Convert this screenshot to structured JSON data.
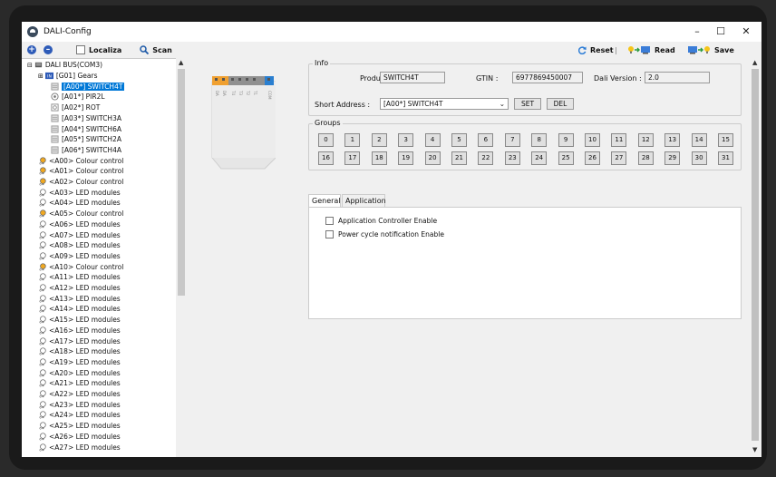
{
  "window": {
    "title": "DALI-Config",
    "minimize": "–",
    "maximize": "☐",
    "close": "✕"
  },
  "toolbar": {
    "add_label": "+",
    "remove_label": "–",
    "localiza_label": "Localiza",
    "scan_label": "Scan",
    "reset_label": "Reset",
    "separator": "|",
    "read_label": "Read",
    "save_label": "Save"
  },
  "tree": {
    "root": "DALI BUS(COM3)",
    "gears": "[G01] Gears",
    "items": [
      "[A00*] SWITCH4T",
      "[A01*] PIR2L",
      "[A02*] ROT",
      "[A03*] SWITCH3A",
      "[A04*] SWITCH6A",
      "[A05*] SWITCH2A",
      "[A06*] SWITCH4A"
    ],
    "gear_items": [
      "<A00> Colour control",
      "<A01> Colour control",
      "<A02> Colour control",
      "<A03> LED modules",
      "<A04> LED modules",
      "<A05> Colour control",
      "<A06> LED modules",
      "<A07> LED modules",
      "<A08> LED modules",
      "<A09> LED modules",
      "<A10> Colour control",
      "<A11> LED modules",
      "<A12> LED modules",
      "<A13> LED modules",
      "<A14> LED modules",
      "<A15> LED modules",
      "<A16> LED modules",
      "<A17> LED modules",
      "<A18> LED modules",
      "<A19> LED modules",
      "<A20> LED modules",
      "<A21> LED modules",
      "<A22> LED modules",
      "<A23> LED modules",
      "<A24> LED modules",
      "<A25> LED modules",
      "<A26> LED modules",
      "<A27> LED modules"
    ]
  },
  "info": {
    "legend": "Info",
    "product_label": "Product :",
    "product_value": "SWITCH4T",
    "gtin_label": "GTIN :",
    "gtin_value": "6977869450007",
    "version_label": "Dali Version :",
    "version_value": "2.0",
    "short_address_label": "Short Address :",
    "short_address_value": "[A00*] SWITCH4T",
    "set_label": "SET",
    "del_label": "DEL"
  },
  "groups": {
    "legend": "Groups",
    "row1": [
      "0",
      "1",
      "2",
      "3",
      "4",
      "5",
      "6",
      "7",
      "8",
      "9",
      "10",
      "11",
      "12",
      "13",
      "14",
      "15"
    ],
    "row2": [
      "16",
      "17",
      "18",
      "19",
      "20",
      "21",
      "22",
      "23",
      "24",
      "25",
      "26",
      "27",
      "28",
      "29",
      "30",
      "31"
    ]
  },
  "tabs": {
    "general": "General",
    "application": "Application"
  },
  "general": {
    "app_controller": "Application Controller Enable",
    "power_cycle": "Power cycle notification Enable"
  },
  "device": {
    "terminal_labels": [
      "DA",
      "DA",
      "T4",
      "T3",
      "T2",
      "T1",
      "COM"
    ],
    "colors": {
      "orange": "#f0a030",
      "gray": "#909090",
      "blue": "#2a7fd0",
      "body": "#e8e8e8"
    }
  },
  "icons": {
    "app": "dali-app-icon",
    "search": "magnifier-icon",
    "reset": "refresh-icon",
    "read": "read-icon",
    "save": "save-icon",
    "bulb": "bulb-icon"
  }
}
